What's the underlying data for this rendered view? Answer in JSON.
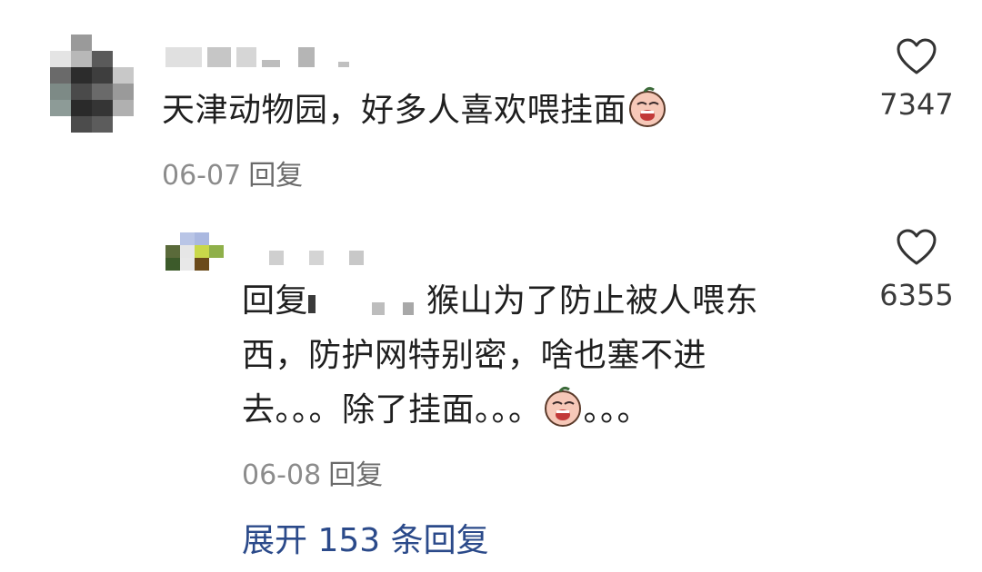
{
  "comment": {
    "text": "天津动物园，好多人喜欢喂挂面",
    "date": "06-07",
    "reply_label": "回复",
    "likes": "7347",
    "emoji": "sob-face-emoji"
  },
  "reply": {
    "prefix": "回复",
    "line1": "猴山为了防止被人喂东",
    "line2": "西，防护网特别密，啥也塞不进",
    "line3_a": "去。。。除了挂面。。。",
    "line3_b": "。。。",
    "date": "06-08",
    "reply_label": "回复",
    "likes": "6355",
    "emoji": "sob-face-emoji"
  },
  "expand_label": "展开 153 条回复",
  "colors": {
    "text": "#1f1f1f",
    "meta": "#8c8c8c",
    "link": "#2b4a8a"
  }
}
